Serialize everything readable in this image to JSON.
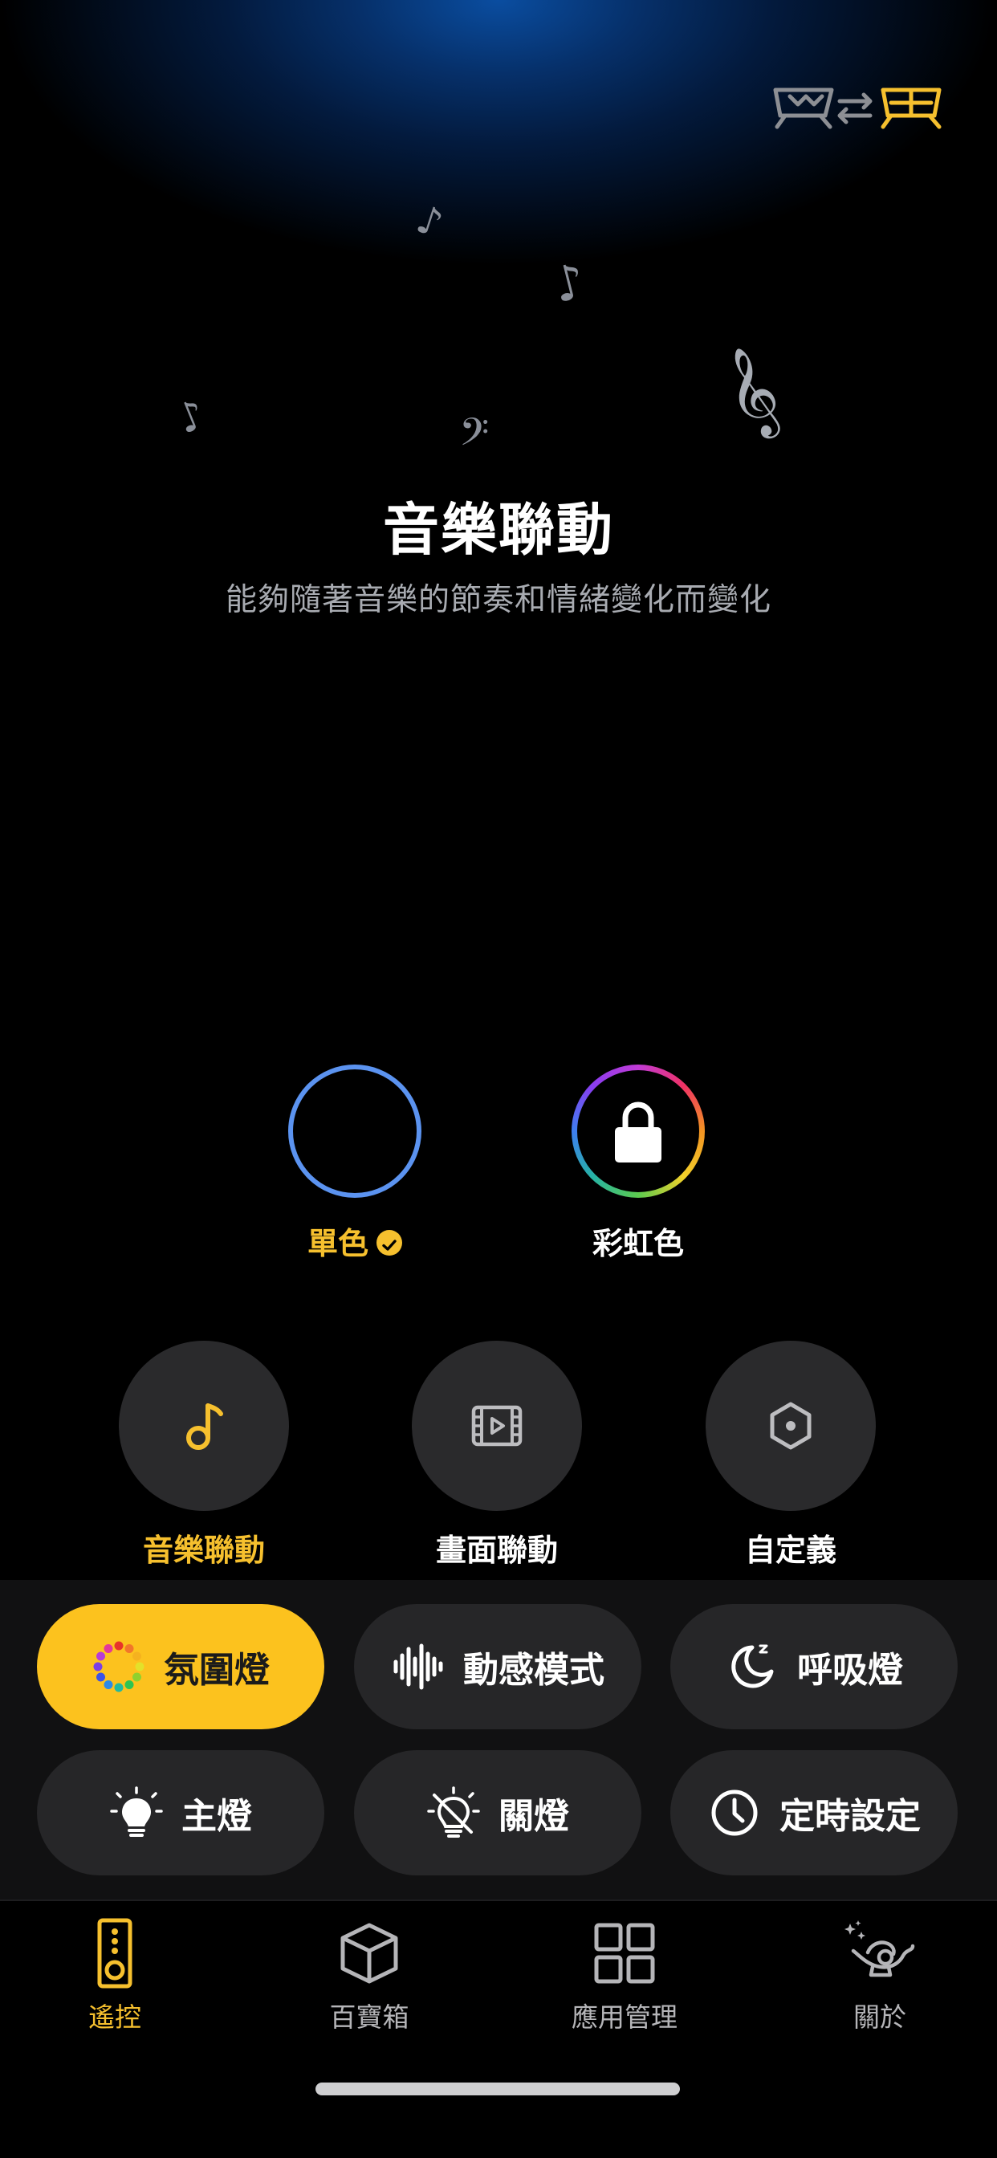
{
  "mode": {
    "title": "音樂聯動",
    "description": "能夠隨著音樂的節奏和情緒變化而變化"
  },
  "header": {
    "switch_icon": "device-switch-icon"
  },
  "decorations": {
    "notes": [
      "♪",
      "♪",
      "♪",
      "𝄢",
      "𝄞"
    ]
  },
  "color_options": [
    {
      "label": "單色",
      "selected": true,
      "ring_color": "#5b93f0"
    },
    {
      "label": "彩虹色",
      "selected": false,
      "locked": true
    }
  ],
  "sub_modes": [
    {
      "label": "音樂聯動",
      "icon": "music-note-icon",
      "active": true
    },
    {
      "label": "畫面聯動",
      "icon": "film-icon",
      "active": false
    },
    {
      "label": "自定義",
      "icon": "hexagon-icon",
      "active": false
    }
  ],
  "controls": [
    {
      "label": "氛圍燈",
      "icon": "rainbow-dots-icon",
      "active": true
    },
    {
      "label": "動感模式",
      "icon": "sound-wave-icon",
      "active": false
    },
    {
      "label": "呼吸燈",
      "icon": "moon-icon",
      "active": false
    },
    {
      "label": "主燈",
      "icon": "bulb-icon",
      "active": false
    },
    {
      "label": "關燈",
      "icon": "bulb-off-icon",
      "active": false
    },
    {
      "label": "定時設定",
      "icon": "clock-icon",
      "active": false
    }
  ],
  "tabs": [
    {
      "label": "遙控",
      "icon": "remote-icon",
      "active": true
    },
    {
      "label": "百寶箱",
      "icon": "box-icon",
      "active": false
    },
    {
      "label": "應用管理",
      "icon": "grid-icon",
      "active": false
    },
    {
      "label": "關於",
      "icon": "lamp-icon",
      "active": false
    }
  ],
  "colors": {
    "accent": "#f6c02e",
    "active_pill": "#fcc21e",
    "pill_bg": "#262628",
    "circle_bg": "#2a2a2c"
  }
}
